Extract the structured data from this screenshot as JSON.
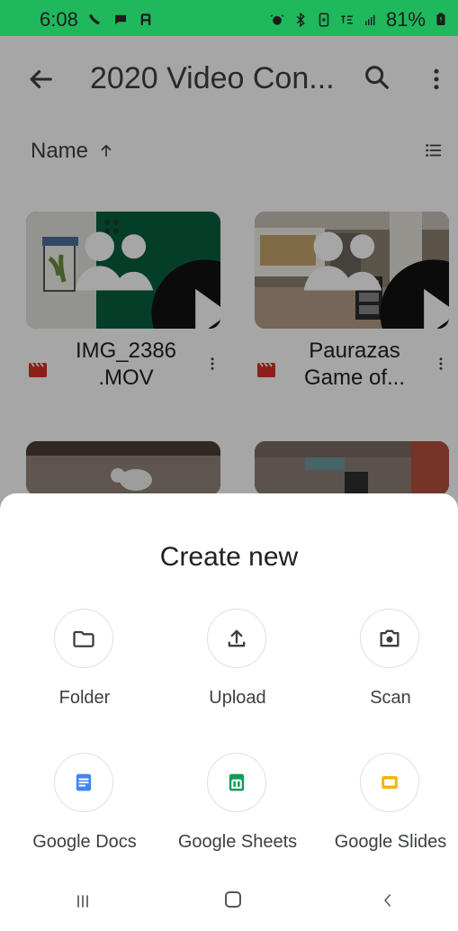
{
  "status_bar": {
    "time": "6:08",
    "battery": "81%"
  },
  "app_bar": {
    "title": "2020 Video Con..."
  },
  "sort": {
    "label": "Name"
  },
  "files": [
    {
      "name": "IMG_2386 .MOV"
    },
    {
      "name": "Paurazas Game of..."
    }
  ],
  "sheet": {
    "title": "Create new",
    "options": [
      {
        "label": "Folder"
      },
      {
        "label": "Upload"
      },
      {
        "label": "Scan"
      },
      {
        "label": "Google Docs"
      },
      {
        "label": "Google Sheets"
      },
      {
        "label": "Google Slides"
      }
    ]
  },
  "colors": {
    "status_green": "#1fb85d",
    "docs_blue": "#4285f4",
    "sheets_green": "#0f9d58",
    "slides_yellow": "#f4b400",
    "file_red": "#d93025"
  },
  "icons": {
    "status_left": [
      "phone-icon",
      "message-icon",
      "a-icon"
    ],
    "status_right": [
      "alarm-icon",
      "bluetooth-icon",
      "battery-saver-icon",
      "lte-icon",
      "signal-icon",
      "battery-icon"
    ],
    "app_bar": [
      "back-arrow-icon",
      "search-icon",
      "more-vert-icon"
    ],
    "sort": [
      "arrow-up-icon",
      "list-view-icon"
    ],
    "sheet": [
      "folder-icon",
      "upload-icon",
      "camera-icon",
      "docs-icon",
      "sheets-icon",
      "slides-icon"
    ],
    "nav": [
      "recent-apps-icon",
      "home-icon",
      "back-icon"
    ]
  }
}
